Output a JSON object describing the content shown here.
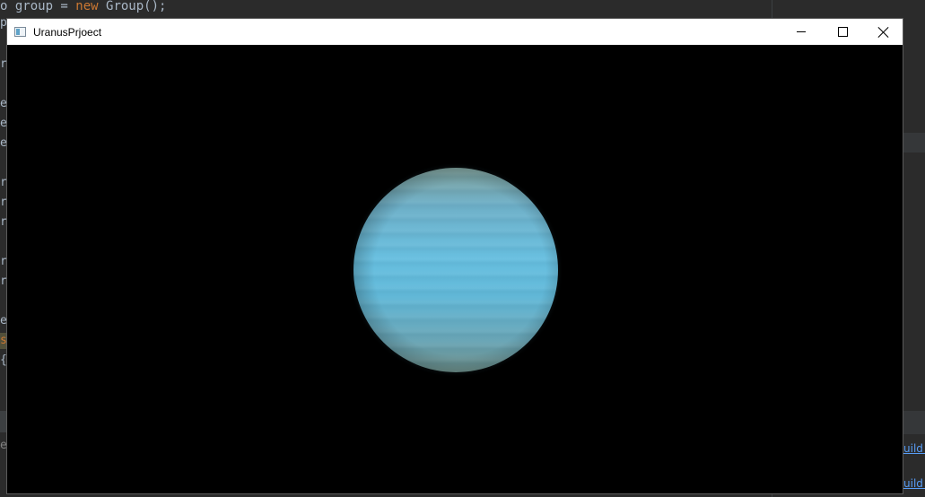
{
  "ide": {
    "code_line_1": {
      "prefix": "o group = ",
      "keyword": "new",
      "suffix": " Group();"
    },
    "gutter_fragments": [
      "p",
      "r",
      "e",
      "e",
      "e",
      "r",
      "r",
      "r",
      "r",
      "r",
      "e",
      "s",
      "{",
      "e"
    ],
    "side_links": [
      "uild c",
      "uild c"
    ]
  },
  "window": {
    "title": "UranusPrjoect",
    "icon": "app-window-icon",
    "controls": {
      "minimize_icon": "minimize-icon",
      "maximize_icon": "maximize-icon",
      "close_icon": "close-icon"
    }
  },
  "scene": {
    "background": "#000000",
    "planet_name": "Uranus",
    "planet_color": "#67bfe0"
  }
}
